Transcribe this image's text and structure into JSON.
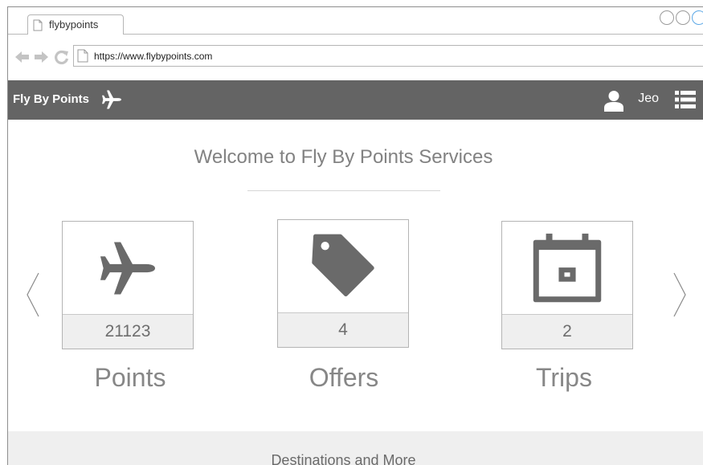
{
  "browser": {
    "tab_title": "flybypoints",
    "url": "https://www.flybypoints.com"
  },
  "header": {
    "brand": "Fly By Points",
    "username": "Jeo"
  },
  "main": {
    "welcome": "Welcome to Fly By Points Services",
    "cards": [
      {
        "title": "Points",
        "count": "21123",
        "icon": "airplane-icon"
      },
      {
        "title": "Offers",
        "count": "4",
        "icon": "price-tag-icon"
      },
      {
        "title": "Trips",
        "count": "2",
        "icon": "calendar-icon"
      }
    ]
  },
  "footer": {
    "label": "Destinations and More"
  },
  "colors": {
    "header_bg": "#646464",
    "icon_gray": "#6a6a6a",
    "count_bg": "#efefef"
  }
}
